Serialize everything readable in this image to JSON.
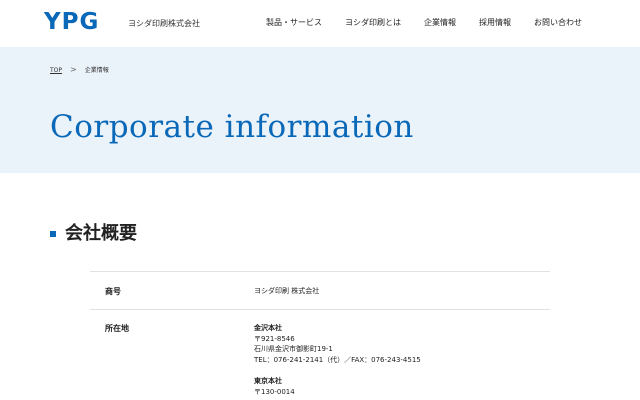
{
  "header": {
    "logo": "YPG",
    "company_name": "ヨシダ印刷株式会社",
    "nav": [
      "製品・サービス",
      "ヨシダ印刷とは",
      "企業情報",
      "採用情報",
      "お問い合わせ"
    ]
  },
  "breadcrumb": {
    "home": "TOP",
    "separator": ">",
    "current": "企業情報"
  },
  "hero": {
    "title": "Corporate information"
  },
  "section": {
    "title": "会社概要"
  },
  "table": {
    "rows": [
      {
        "label": "商号",
        "value": "ヨシダ印刷 株式会社"
      },
      {
        "label": "所在地",
        "offices": [
          {
            "name": "金沢本社",
            "lines": [
              "〒921-8546",
              "石川県金沢市御影町19-1",
              "TEL：076-241-2141（代）／FAX：076-243-4515"
            ]
          },
          {
            "name": "東京本社",
            "lines": [
              "〒130-0014"
            ]
          }
        ]
      }
    ]
  },
  "colors": {
    "accent": "#0a68b8",
    "hero_bg": "#eaf2fa"
  }
}
